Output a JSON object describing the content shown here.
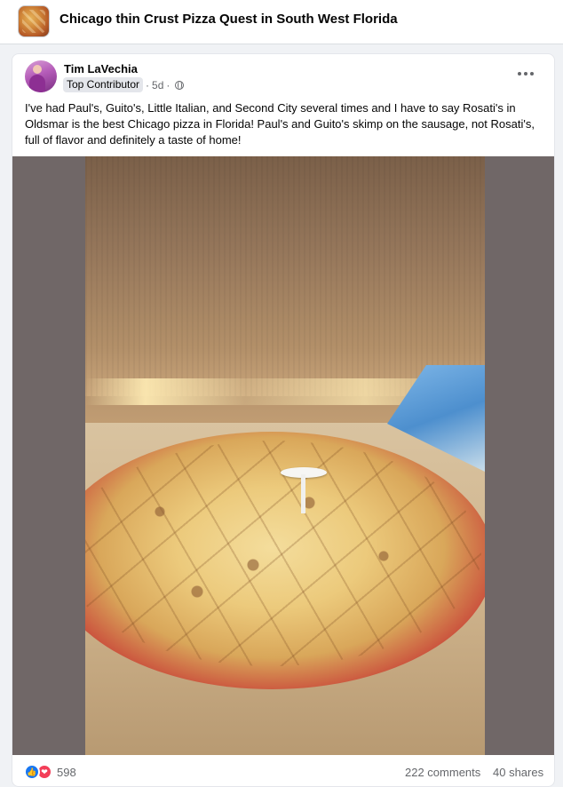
{
  "group": {
    "title": "Chicago thin Crust Pizza Quest in South West Florida",
    "thumbnail_icon": "pizza-thumbnail"
  },
  "post": {
    "author": "Tim LaVechia",
    "badge": "Top Contributor",
    "separator": "·",
    "time": "5d",
    "privacy_icon": "globe-icon",
    "text": "I've had Paul's, Guito's,  Little Italian,  and Second City several times and I have to say Rosati's in Oldsmar is the best Chicago pizza in Florida! Paul's and Guito's skimp on the sausage, not Rosati's,  full of flavor and definitely a taste of home!",
    "photo_icon": "pizza-photo"
  },
  "footer": {
    "reaction_count": "598",
    "comments": "222 comments",
    "shares": "40 shares",
    "reaction_icons": [
      "like-icon",
      "love-icon"
    ]
  },
  "colors": {
    "like": "#1877f2",
    "love": "#f33e58",
    "secondary_text": "#65676b"
  }
}
